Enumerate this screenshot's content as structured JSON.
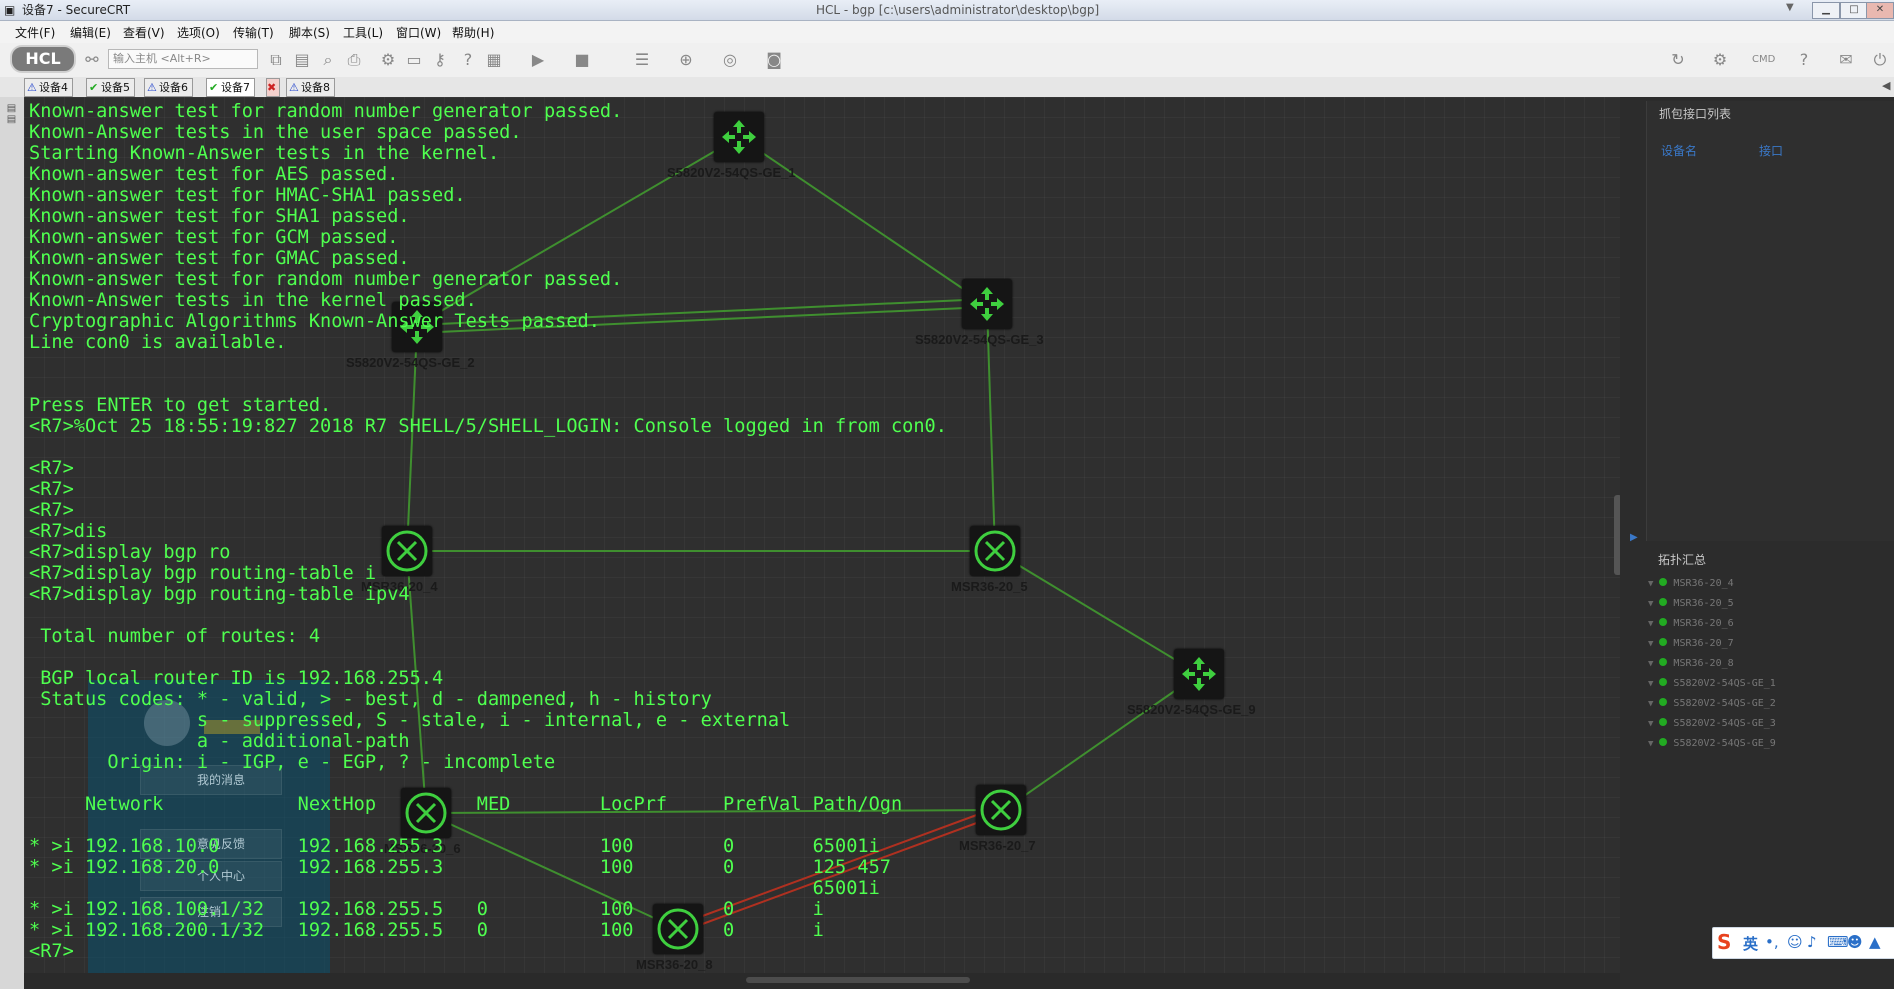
{
  "window": {
    "title": "设备7 - SecureCRT",
    "hcl_title": "HCL - bgp [c:\\users\\administrator\\desktop\\bgp]",
    "controls": [
      "▁",
      "□",
      "✕"
    ]
  },
  "menu": [
    "文件(F)",
    "编辑(E)",
    "查看(V)",
    "选项(O)",
    "传输(T)",
    "脚本(S)",
    "工具(L)",
    "窗口(W)",
    "帮助(H)"
  ],
  "toolbar": {
    "logo": "HCL",
    "host_placeholder": "输入主机 <Alt+R>"
  },
  "tabs": [
    {
      "label": "设备4",
      "status": "warn",
      "active": false
    },
    {
      "label": "设备5",
      "status": "ok",
      "active": false
    },
    {
      "label": "设备6",
      "status": "warn",
      "active": false
    },
    {
      "label": "设备7",
      "status": "ok",
      "active": true
    },
    {
      "label": "",
      "status": "error",
      "active": false
    },
    {
      "label": "设备8",
      "status": "warn",
      "active": false
    }
  ],
  "terminal": {
    "lines": [
      "Known-answer test for random number generator passed.",
      "Known-Answer tests in the user space passed.",
      "Starting Known-Answer tests in the kernel.",
      "Known-answer test for AES passed.",
      "Known-answer test for HMAC-SHA1 passed.",
      "Known-answer test for SHA1 passed.",
      "Known-answer test for GCM passed.",
      "Known-answer test for GMAC passed.",
      "Known-answer test for random number generator passed.",
      "Known-Answer tests in the kernel passed.",
      "Cryptographic Algorithms Known-Answer Tests passed.",
      "Line con0 is available.",
      "",
      "",
      "Press ENTER to get started.",
      "<R7>%Oct 25 18:55:19:827 2018 R7 SHELL/5/SHELL_LOGIN: Console logged in from con0.",
      "",
      "<R7>",
      "<R7>",
      "<R7>",
      "<R7>dis",
      "<R7>display bgp ro",
      "<R7>display bgp routing-table i",
      "<R7>display bgp routing-table ipv4",
      "",
      " Total number of routes: 4",
      "",
      " BGP local router ID is 192.168.255.4",
      " Status codes: * - valid, > - best, d - dampened, h - history",
      "               s - suppressed, S - stale, i - internal, e - external",
      "               a - additional-path",
      "       Origin: i - IGP, e - EGP, ? - incomplete",
      "",
      "     Network            NextHop         MED        LocPrf     PrefVal Path/Ogn",
      "",
      "* >i 192.168.10.0       192.168.255.3              100        0       65001i",
      "* >i 192.168.20.0       192.168.255.3              100        0       125 457",
      "                                                                      65001i",
      "* >i 192.168.100.1/32   192.168.255.5   0          100        0       i",
      "* >i 192.168.200.1/32   192.168.255.5   0          100        0       i",
      "<R7>"
    ]
  },
  "topology": {
    "devices": [
      {
        "id": "S5820V2-54QS-GE_1",
        "label": "S5820V2-54QS-GE_1",
        "kind": "switch"
      },
      {
        "id": "S5820V2-54QS-GE_2",
        "label": "S5820V2-54QS-GE_2",
        "kind": "switch"
      },
      {
        "id": "S5820V2-54QS-GE_3",
        "label": "S5820V2-54QS-GE_3",
        "kind": "switch"
      },
      {
        "id": "MSR36-20_4",
        "label": "MSR36-20_4",
        "kind": "router"
      },
      {
        "id": "MSR36-20_5",
        "label": "MSR36-20_5",
        "kind": "router"
      },
      {
        "id": "S5820V2-54QS-GE_9",
        "label": "S5820V2-54QS-GE_9",
        "kind": "switch"
      },
      {
        "id": "MSR36-20_6",
        "label": "MSR36-20_6",
        "kind": "router"
      },
      {
        "id": "MSR36-20_7",
        "label": "MSR36-20_7",
        "kind": "router"
      },
      {
        "id": "MSR36-20_8",
        "label": "MSR36-20_8",
        "kind": "router"
      }
    ]
  },
  "overlay_menu": [
    "我的消息",
    "意见反馈",
    "个人中心",
    "注销"
  ],
  "right_panel": {
    "capture_title": "抓包接口列表",
    "col_device": "设备名",
    "col_interface": "接口",
    "topo_title": "拓扑汇总",
    "topo_items": [
      "MSR36-20_4",
      "MSR36-20_5",
      "MSR36-20_6",
      "MSR36-20_7",
      "MSR36-20_8",
      "S5820V2-54QS-GE_1",
      "S5820V2-54QS-GE_2",
      "S5820V2-54QS-GE_3",
      "S5820V2-54QS-GE_9"
    ]
  },
  "ime": {
    "logo": "S",
    "lang": "英"
  },
  "colors": {
    "terminal_text": "#4fff4f",
    "link_green": "#3f8f2f",
    "link_red": "#b03020"
  }
}
